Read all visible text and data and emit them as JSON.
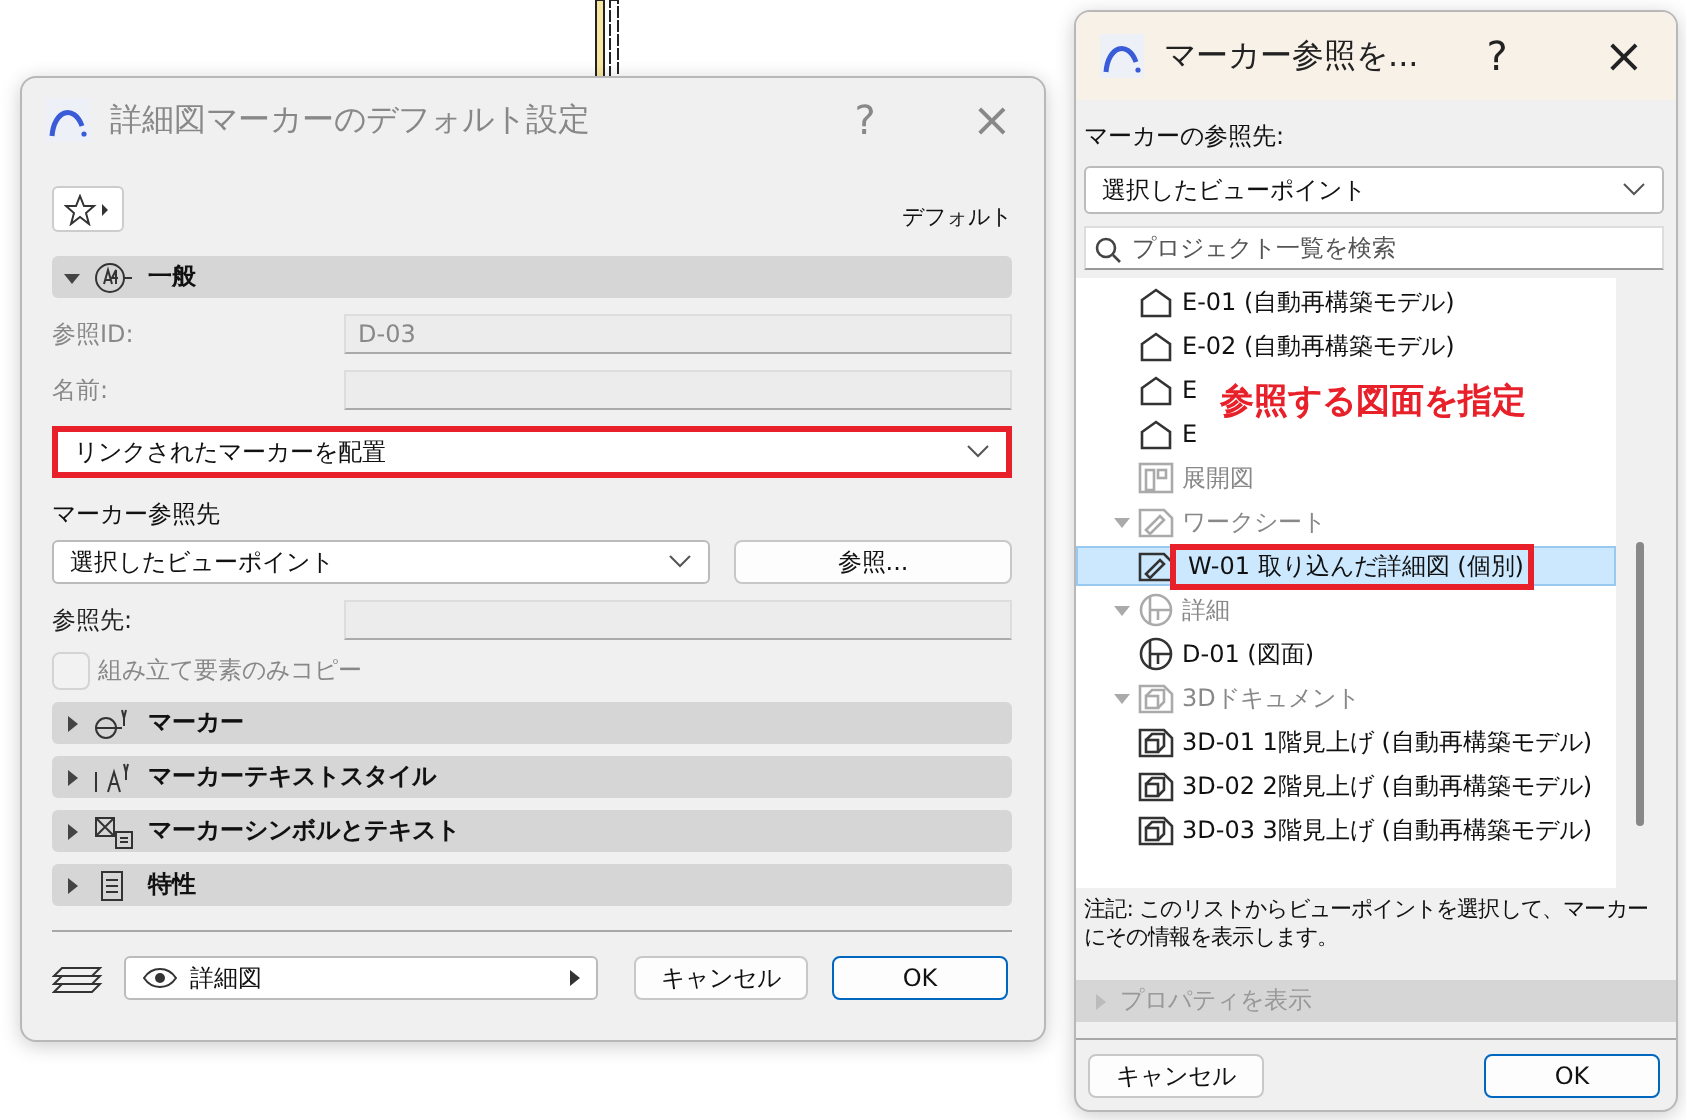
{
  "left_dialog": {
    "title": "詳細図マーカーのデフォルト設定",
    "help": "?",
    "close": "×",
    "default_label": "デフォルト",
    "general": {
      "label": "一般",
      "expanded": true
    },
    "fields": [
      {
        "label": "参照ID:",
        "value": "D-03",
        "disabled": true
      },
      {
        "label": "名前:",
        "disabled": true
      }
    ],
    "placement_dropdown": {
      "value": "リンクされたマーカーを配置",
      "highlighted": true
    },
    "marker_ref_label": "マーカー参照先",
    "ref_dropdown": {
      "value": "選択したビューポイント"
    },
    "browse_button": "参照...",
    "ref_target": {
      "label": "参照先:"
    },
    "checkbox": {
      "label": "組み立て要素のみコピー",
      "checked": false,
      "disabled": true
    },
    "sections": [
      {
        "label": "マーカー",
        "kind": "marker",
        "expanded": false
      },
      {
        "label": "マーカーテキストスタイル",
        "kind": "text_style",
        "expanded": false
      },
      {
        "label": "マーカーシンボルとテキスト",
        "kind": "symbol",
        "expanded": false
      },
      {
        "label": "特性",
        "kind": "properties",
        "expanded": false
      }
    ],
    "layer_dropdown": {
      "value": "詳細図"
    },
    "cancel": "キャンセル",
    "ok": "OK"
  },
  "right_dialog": {
    "title": "マーカー参照を...",
    "help": "?",
    "close": "×",
    "ref_label": "マーカーの参照先:",
    "dropdown": {
      "value": "選択したビューポイント"
    },
    "search": {
      "placeholder": "プロジェクト一覧を検索"
    },
    "tree": [
      {
        "children": [
          {
            "label": "E-01 (自動再構築モデル)",
            "kind": "view",
            "selected": false
          },
          {
            "label": "E-02 (自動再構築モデル)",
            "kind": "view",
            "selected": false
          },
          {
            "label": "E",
            "kind": "view",
            "selected": false
          },
          {
            "label": "E",
            "kind": "view",
            "selected": false
          }
        ]
      },
      {
        "label": "展開図",
        "kind": "elevation"
      },
      {
        "label": "ワークシート",
        "kind": "worksheet",
        "expanded": true,
        "children": [
          {
            "label": "W-01 取り込んだ詳細図 (個別)",
            "kind": "worksheet",
            "selected": true,
            "highlighted": true
          }
        ]
      },
      {
        "label": "詳細",
        "kind": "detail",
        "expanded": true,
        "children": [
          {
            "label": "D-01 (図面)",
            "kind": "detail",
            "selected": false
          }
        ]
      },
      {
        "label": "3Dドキュメント",
        "kind": "doc3d",
        "expanded": true,
        "children": [
          {
            "label": "3D-01 1階見上げ (自動再構築モデル)",
            "kind": "doc3d",
            "selected": false
          },
          {
            "label": "3D-02 2階見上げ (自動再構築モデル)",
            "kind": "doc3d",
            "selected": false
          },
          {
            "label": "3D-03 3階見上げ (自動再構築モデル)",
            "kind": "doc3d",
            "selected": false
          }
        ]
      }
    ],
    "annotation": {
      "text": "参照する図面を指定"
    },
    "note": "注記: このリストからビューポイントを選択して、マーカーにその情報を表示します。",
    "properties": {
      "label": "プロパティを表示",
      "expanded": false,
      "disabled": true
    },
    "cancel": "キャンセル",
    "ok": "OK"
  }
}
